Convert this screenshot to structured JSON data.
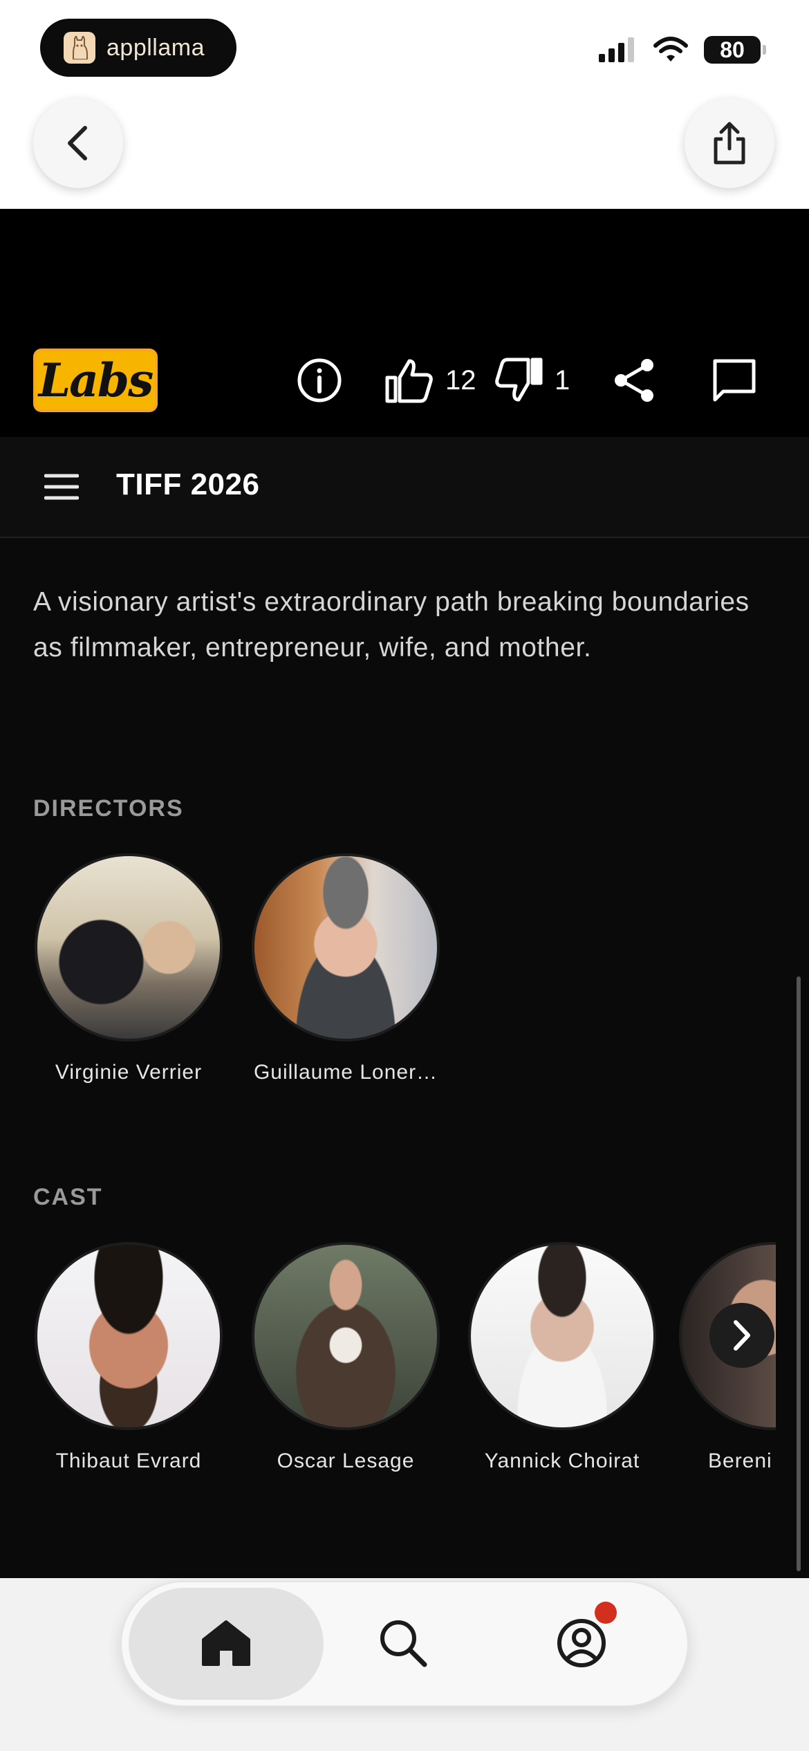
{
  "status_bar": {
    "app_name": "appllama",
    "battery": "80"
  },
  "header": {
    "logo_text": "Labs",
    "likes": "12",
    "dislikes": "1"
  },
  "nav": {
    "title": "TIFF 2026"
  },
  "description": "A visionary artist's extraordinary path breaking boundaries as filmmaker, entrepreneur, wife, and mother.",
  "directors": {
    "label": "DIRECTORS",
    "people": [
      {
        "name": "Virginie Verrier"
      },
      {
        "name": "Guillaume Loner…"
      }
    ]
  },
  "cast": {
    "label": "CAST",
    "people": [
      {
        "name": "Thibaut Evrard"
      },
      {
        "name": "Oscar Lesage"
      },
      {
        "name": "Yannick Choirat"
      },
      {
        "name": "Bereni"
      }
    ]
  },
  "tabs": [
    {
      "icon": "home-icon",
      "active": true
    },
    {
      "icon": "search-icon",
      "active": false
    },
    {
      "icon": "profile-icon",
      "active": false
    }
  ],
  "colors": {
    "accent": "#f7b500",
    "background": "#0a0a0a",
    "notification": "#d32f1e"
  }
}
